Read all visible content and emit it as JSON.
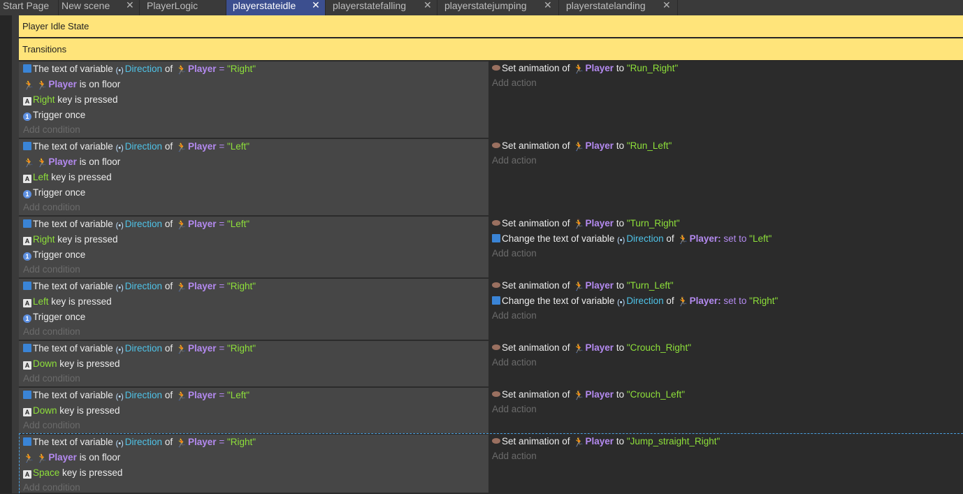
{
  "tabs": [
    {
      "label": "Start Page",
      "closable": false
    },
    {
      "label": "New scene",
      "closable": true
    },
    {
      "label": "PlayerLogic",
      "closable": false
    },
    {
      "label": "playerstateidle",
      "closable": true,
      "active": true
    },
    {
      "label": "playerstatefalling",
      "closable": true
    },
    {
      "label": "playerstatejumping",
      "closable": true
    },
    {
      "label": "playerstatelanding",
      "closable": true
    }
  ],
  "close_glyph": "✕",
  "comments": [
    "Player Idle State",
    "Transitions"
  ],
  "common": {
    "the_text_of_variable": "The text of variable",
    "direction": "Direction",
    "of": "of",
    "player": "Player",
    "eq": "=",
    "is_on_floor": "is on floor",
    "key_is_pressed": "key is pressed",
    "trigger_once": "Trigger once",
    "add_condition": "Add condition",
    "add_action": "Add action",
    "set_animation_of": "Set animation of",
    "to": "to",
    "change_text_of_variable": "Change the text of variable",
    "player_colon": "Player:",
    "set_to": "set to",
    "key_icon": "A",
    "once_icon": "1"
  },
  "events": [
    {
      "dir": "\"Right\"",
      "floor": true,
      "key": "Right",
      "once": true,
      "anim": "\"Run_Right\"",
      "change": null
    },
    {
      "dir": "\"Left\"",
      "floor": true,
      "key": "Left",
      "once": true,
      "anim": "\"Run_Left\"",
      "change": null
    },
    {
      "dir": "\"Left\"",
      "floor": false,
      "key": "Right",
      "once": true,
      "anim": "\"Turn_Right\"",
      "change": "\"Left\""
    },
    {
      "dir": "\"Right\"",
      "floor": false,
      "key": "Left",
      "once": true,
      "anim": "\"Turn_Left\"",
      "change": "\"Right\""
    },
    {
      "dir": "\"Right\"",
      "floor": false,
      "key": "Down",
      "once": false,
      "anim": "\"Crouch_Right\"",
      "change": null
    },
    {
      "dir": "\"Left\"",
      "floor": false,
      "key": "Down",
      "once": false,
      "anim": "\"Crouch_Left\"",
      "change": null
    },
    {
      "dir": "\"Right\"",
      "floor": true,
      "key": "Space",
      "once": false,
      "anim": "\"Jump_straight_Right\"",
      "change": null
    }
  ]
}
